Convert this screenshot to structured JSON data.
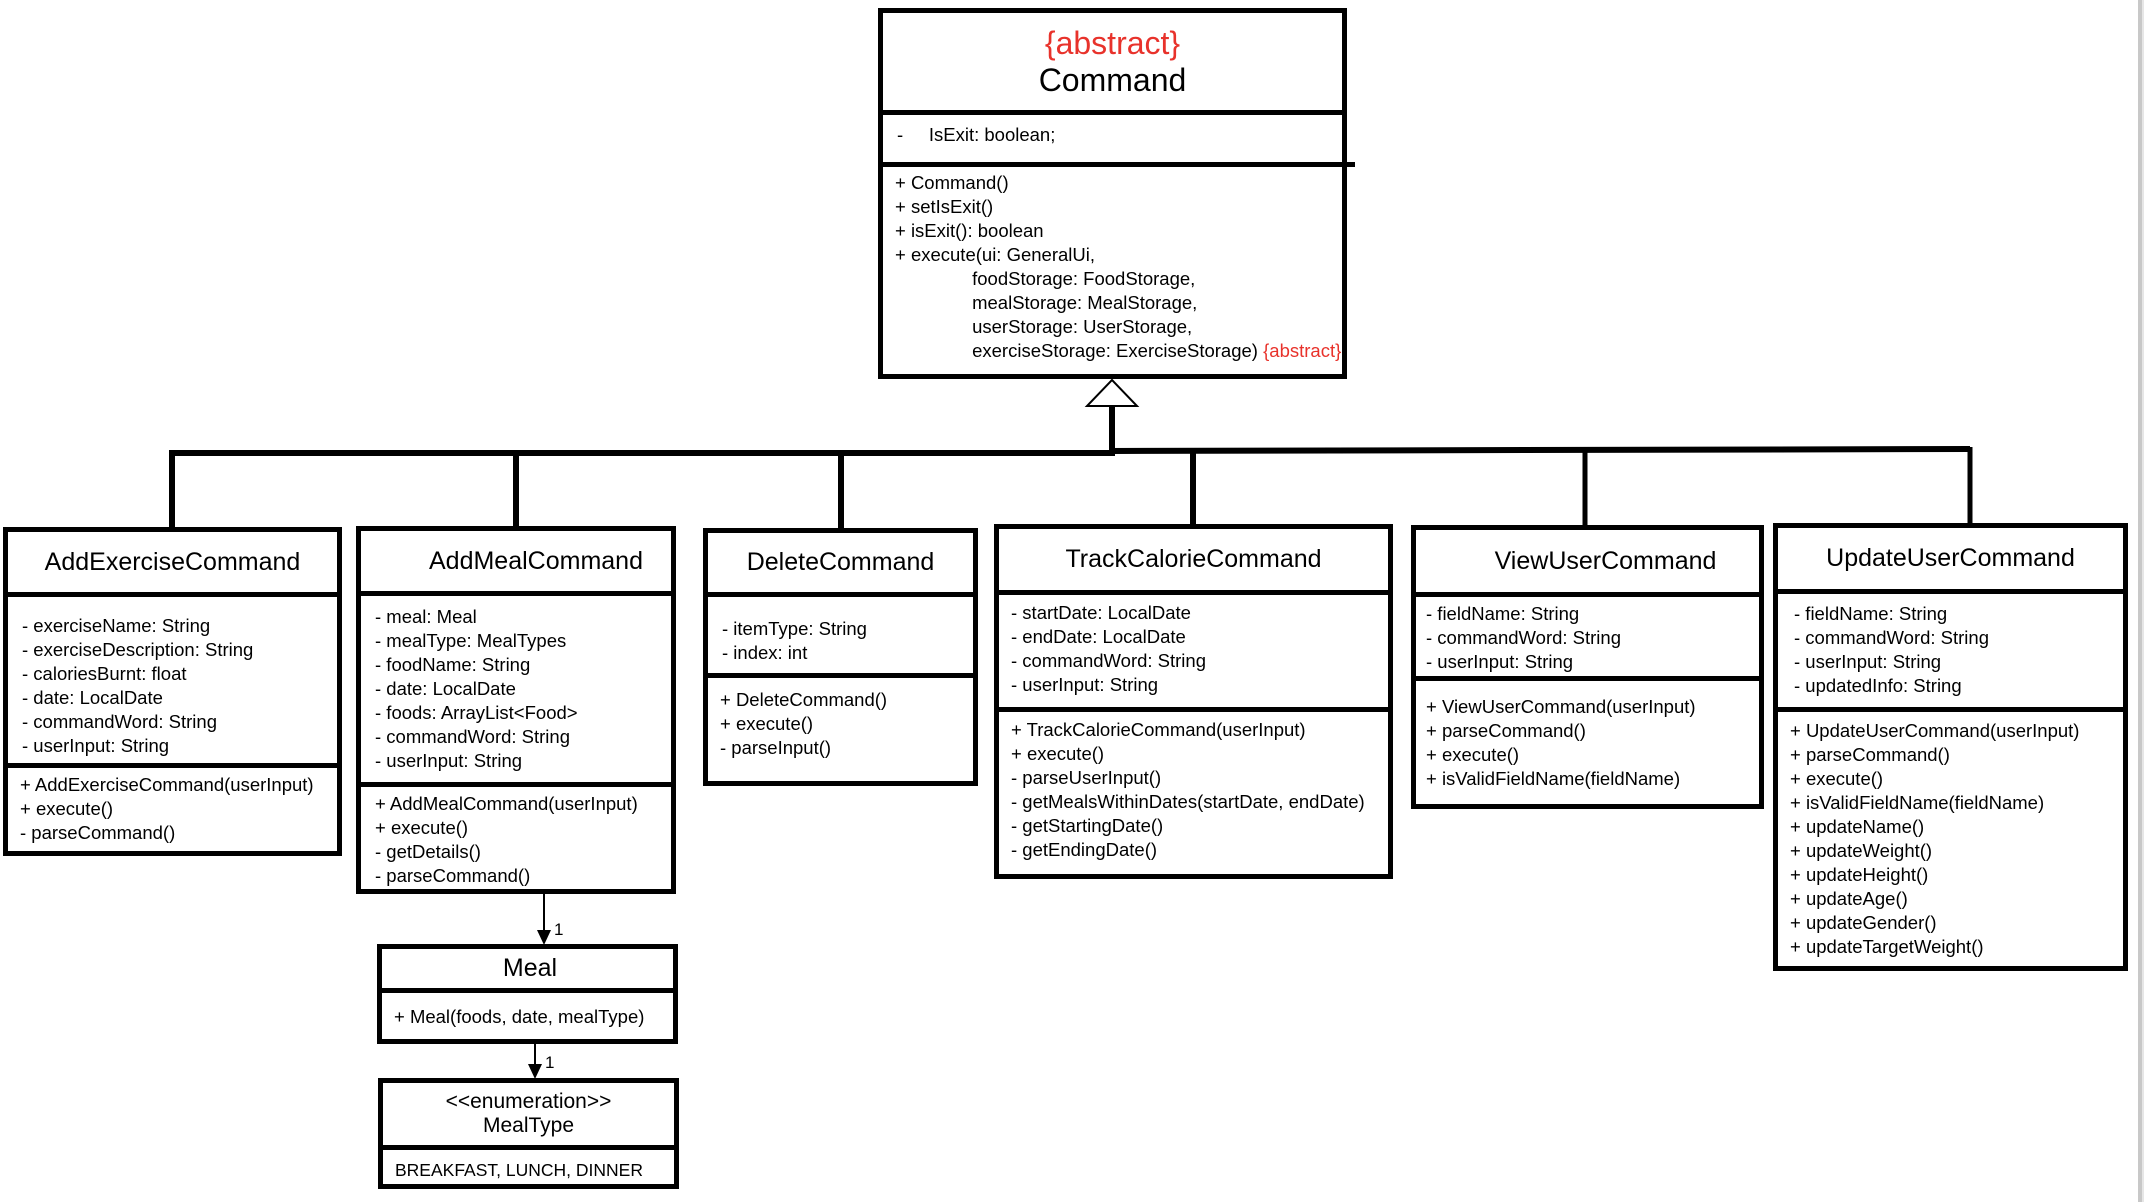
{
  "diagram": {
    "type": "uml-class-diagram",
    "accent_color": "#e8322b",
    "relationships": [
      {
        "kind": "generalization",
        "parent": "Command",
        "children": [
          "AddExerciseCommand",
          "AddMealCommand",
          "DeleteCommand",
          "TrackCalorieCommand",
          "ViewUserCommand",
          "UpdateUserCommand"
        ]
      },
      {
        "kind": "association",
        "from": "AddMealCommand",
        "to": "Meal",
        "multiplicity": "1"
      },
      {
        "kind": "association",
        "from": "Meal",
        "to": "MealType",
        "multiplicity": "1"
      }
    ]
  },
  "command": {
    "stereotype": "{abstract}",
    "name": "Command",
    "attributes": [
      "-     IsExit: boolean;"
    ],
    "methods": [
      "+ Command()",
      "+ setIsExit()",
      "+ isExit(): boolean",
      "+ execute(ui: GeneralUi,",
      "               foodStorage: FoodStorage,",
      "               mealStorage: MealStorage,",
      "               userStorage: UserStorage,",
      "               exerciseStorage: ExerciseStorage) "
    ],
    "method_suffix": "{abstract}"
  },
  "classes": {
    "add_exercise": {
      "name": "AddExerciseCommand",
      "attributes": [
        "- exerciseName: String",
        "- exerciseDescription: String",
        "- caloriesBurnt: float",
        "- date: LocalDate",
        "- commandWord: String",
        "- userInput: String"
      ],
      "methods": [
        "+ AddExerciseCommand(userInput)",
        "+ execute()",
        "- parseCommand()"
      ]
    },
    "add_meal": {
      "name": "AddMealCommand",
      "attributes": [
        "- meal: Meal",
        "- mealType: MealTypes",
        "- foodName: String",
        "- date: LocalDate",
        "- foods: ArrayList<Food>",
        "- commandWord: String",
        "- userInput: String"
      ],
      "methods": [
        "+ AddMealCommand(userInput)",
        "+ execute()",
        "- getDetails()",
        "- parseCommand()"
      ]
    },
    "delete": {
      "name": "DeleteCommand",
      "attributes": [
        "- itemType: String",
        "- index: int"
      ],
      "methods": [
        "+ DeleteCommand()",
        "+ execute()",
        "- parseInput()"
      ]
    },
    "track_calorie": {
      "name": "TrackCalorieCommand",
      "attributes": [
        "- startDate: LocalDate",
        "- endDate: LocalDate",
        "- commandWord: String",
        "- userInput: String"
      ],
      "methods": [
        "+ TrackCalorieCommand(userInput)",
        "+ execute()",
        "- parseUserInput()",
        "- getMealsWithinDates(startDate, endDate)",
        "- getStartingDate()",
        "- getEndingDate()"
      ]
    },
    "view_user": {
      "name": "ViewUserCommand",
      "attributes": [
        "- fieldName: String",
        "- commandWord: String",
        "- userInput: String"
      ],
      "methods": [
        "+ ViewUserCommand(userInput)",
        "+ parseCommand()",
        "+ execute()",
        "+ isValidFieldName(fieldName)"
      ]
    },
    "update_user": {
      "name": "UpdateUserCommand",
      "attributes": [
        "- fieldName: String",
        "- commandWord: String",
        "- userInput: String",
        "- updatedInfo: String"
      ],
      "methods": [
        "+ UpdateUserCommand(userInput)",
        "+ parseCommand()",
        "+ execute()",
        "+ isValidFieldName(fieldName)",
        "+ updateName()",
        "+ updateWeight()",
        "+ updateHeight()",
        "+ updateAge()",
        "+ updateGender()",
        "+ updateTargetWeight()"
      ]
    },
    "meal": {
      "name": "Meal",
      "methods": [
        "+ Meal(foods, date, mealType)"
      ]
    },
    "meal_type": {
      "stereotype": "<<enumeration>>",
      "name": "MealType",
      "values": [
        "BREAKFAST, LUNCH, DINNER"
      ]
    }
  },
  "multiplicities": {
    "addmeal_to_meal": "1",
    "meal_to_mealtype": "1"
  }
}
